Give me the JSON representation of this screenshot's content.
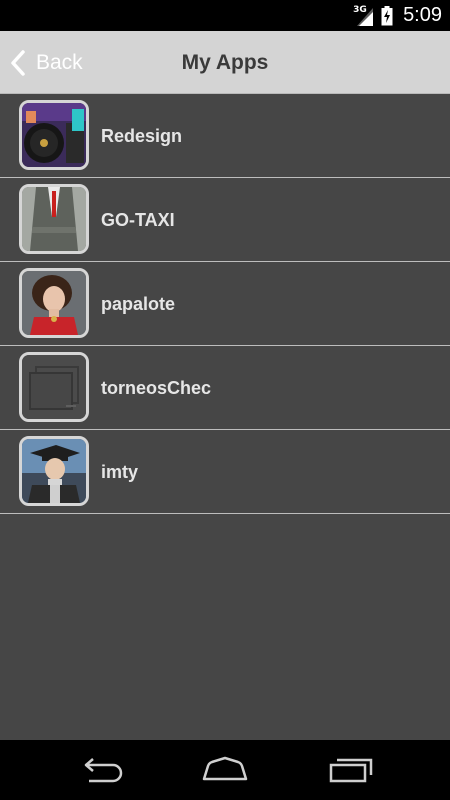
{
  "status_bar": {
    "network_type": "3G",
    "time": "5:09",
    "icons": [
      "signal-icon",
      "battery-charging-icon"
    ]
  },
  "header": {
    "back_label": "Back",
    "title": "My Apps",
    "background_color": "#d4d4d4"
  },
  "apps": [
    {
      "name": "Redesign",
      "icon": "dj-turntable-thumbnail"
    },
    {
      "name": "GO-TAXI",
      "icon": "suited-man-thumbnail"
    },
    {
      "name": "papalote",
      "icon": "woman-portrait-thumbnail"
    },
    {
      "name": "torneosChec",
      "icon": "placeholder-stack-thumbnail"
    },
    {
      "name": "imty",
      "icon": "graduate-portrait-thumbnail"
    }
  ],
  "nav_bar": {
    "buttons": [
      "back-nav-icon",
      "home-nav-icon",
      "recents-nav-icon"
    ]
  }
}
